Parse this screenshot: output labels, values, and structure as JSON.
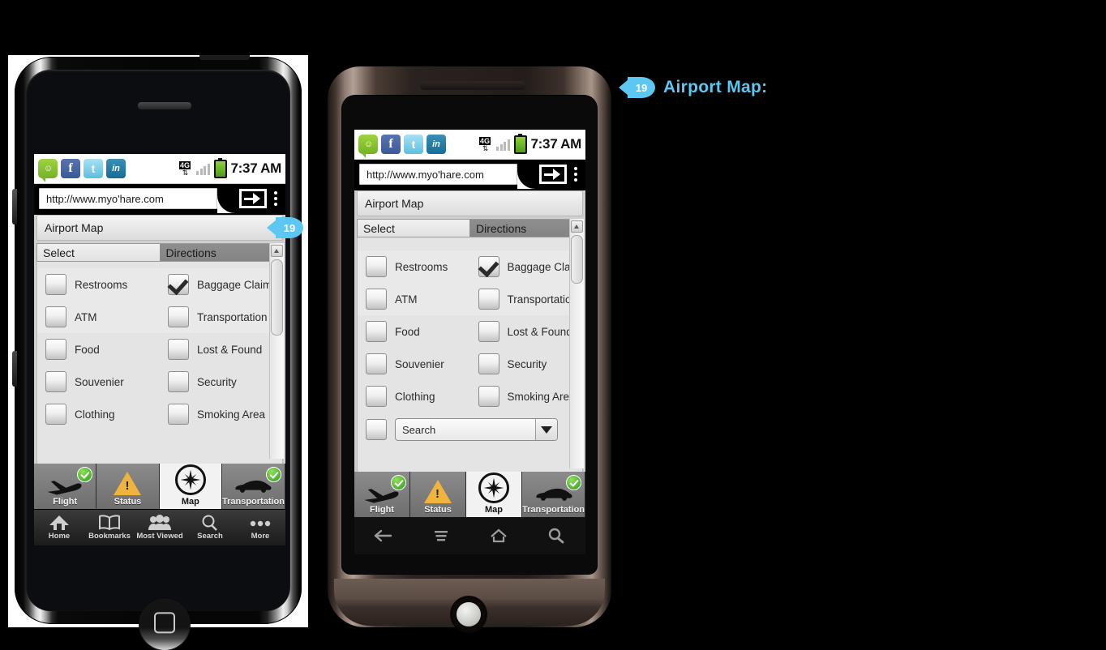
{
  "statusbar": {
    "time": "7:37 AM",
    "network": "4G",
    "icons": [
      "sms-icon",
      "facebook-icon",
      "twitter-icon",
      "linkedin-icon",
      "4g-icon",
      "signal-icon",
      "battery-icon"
    ],
    "sms_glyph": "☺",
    "facebook_glyph": "f",
    "twitter_glyph": "t",
    "linkedin_glyph": "in"
  },
  "browser": {
    "url": "http://www.myo'hare.com",
    "go_label": "go-arrow-icon",
    "menu_label": "overflow-menu-icon"
  },
  "page": {
    "title": "Airport Map",
    "tabs": [
      {
        "label": "Select",
        "selected": true
      },
      {
        "label": "Directions",
        "selected": false
      }
    ],
    "rows": [
      {
        "left": {
          "label": "Restrooms",
          "checked": false
        },
        "right": {
          "label": "Baggage Claim",
          "checked": true
        },
        "highlight": true
      },
      {
        "left": {
          "label": "ATM",
          "checked": false
        },
        "right": {
          "label": "Transportation",
          "checked": false
        },
        "highlight": true
      },
      {
        "left": {
          "label": "Food",
          "checked": false
        },
        "right": {
          "label": "Lost & Found",
          "checked": false
        },
        "highlight": false
      },
      {
        "left": {
          "label": "Souvenier",
          "checked": false
        },
        "right": {
          "label": "Security",
          "checked": false
        },
        "highlight": false
      },
      {
        "left": {
          "label": "Clothing",
          "checked": false
        },
        "right": {
          "label": "Smoking Area",
          "checked": false
        },
        "highlight": false
      }
    ],
    "search": {
      "value": "Search",
      "checked": false
    }
  },
  "app_tabs": [
    {
      "label": "Flight",
      "icon": "airplane-icon",
      "badge": true,
      "active": false
    },
    {
      "label": "Status",
      "icon": "warning-icon",
      "badge": false,
      "active": false
    },
    {
      "label": "Map",
      "icon": "compass-icon",
      "badge": false,
      "active": true
    },
    {
      "label": "Transportation",
      "icon": "car-icon",
      "badge": true,
      "active": false
    }
  ],
  "ios_toolbar": [
    {
      "label": "Home",
      "icon": "home-icon"
    },
    {
      "label": "Bookmarks",
      "icon": "book-icon"
    },
    {
      "label": "Most Viewed",
      "icon": "people-icon"
    },
    {
      "label": "Search",
      "icon": "magnifier-icon"
    },
    {
      "label": "More",
      "icon": "ellipsis-icon"
    }
  ],
  "android_softkeys": [
    "back-icon",
    "menu-icon",
    "home-icon",
    "search-icon"
  ],
  "callout": {
    "number": "19",
    "text": "Airport Map:",
    "color": "#5cc8f2"
  },
  "badge": {
    "number": "19"
  }
}
